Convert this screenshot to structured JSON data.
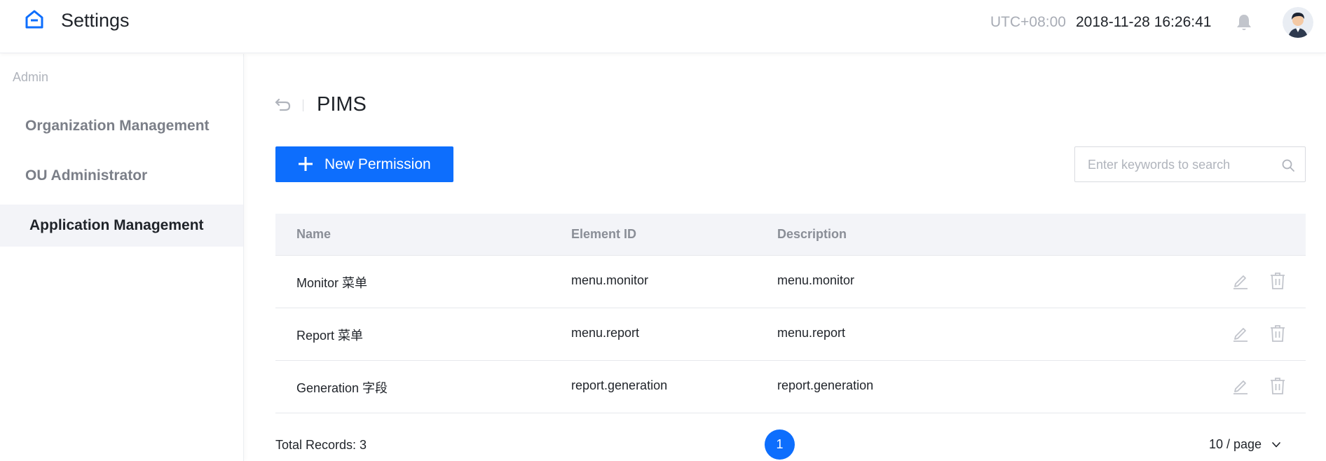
{
  "header": {
    "title": "Settings",
    "timezone": "UTC+08:00",
    "datetime": "2018-11-28 16:26:41",
    "icons": {
      "logo": "home-icon",
      "notifications": "bell-icon",
      "user": "avatar"
    }
  },
  "sidebar": {
    "section_label": "Admin",
    "items": [
      {
        "label": "Organization Management",
        "active": false
      },
      {
        "label": "OU Administrator",
        "active": false
      },
      {
        "label": "Application Management",
        "active": true
      }
    ]
  },
  "main": {
    "title": "PIMS",
    "new_button_label": "New Permission",
    "search": {
      "placeholder": "Enter keywords to search",
      "value": ""
    },
    "table": {
      "columns": [
        "Name",
        "Element ID",
        "Description"
      ],
      "rows": [
        {
          "name": "Monitor 菜单",
          "element_id": "menu.monitor",
          "description": "menu.monitor"
        },
        {
          "name": "Report 菜单",
          "element_id": "menu.report",
          "description": "menu.report"
        },
        {
          "name": "Generation 字段",
          "element_id": "report.generation",
          "description": "report.generation"
        }
      ]
    },
    "pagination": {
      "total": "Total Records: 3",
      "current_page": "1",
      "page_size": "10 / page"
    }
  },
  "colors": {
    "primary": "#0d6efd",
    "muted": "#b0b4bc",
    "header_bg": "#f3f4f8"
  }
}
